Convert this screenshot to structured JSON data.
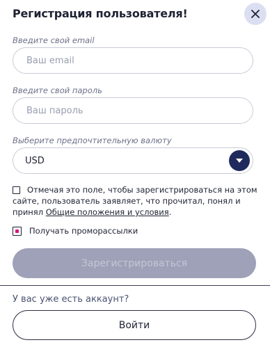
{
  "modal": {
    "title": "Регистрация пользователя!"
  },
  "form": {
    "email": {
      "label": "Введите свой email",
      "placeholder": "Ваш email",
      "value": ""
    },
    "password": {
      "label": "Введите свой пароль",
      "placeholder": "Ваш пароль",
      "value": ""
    },
    "currency": {
      "label": "Выберите предпочтительную валюту",
      "selected": "USD"
    },
    "terms": {
      "text": "Отмечая это поле, чтобы зарегистрироваться на этом сайте, пользователь заявляет, что прочитал, понял и принял",
      "link": "Общие положения и условия",
      "suffix": ".",
      "checked": false
    },
    "promo": {
      "label": "Получать проморассылки",
      "checked": true
    },
    "submit_label": "Зарегистрироваться"
  },
  "footer": {
    "question": "У вас уже есть аккаунт?",
    "login_label": "Войти"
  },
  "colors": {
    "accent": "#1f2a5c",
    "checkbox_mark": "#d8177f",
    "disabled_button": "#9ea1b8"
  },
  "icons": {
    "close": "close-icon",
    "dropdown": "chevron-down-icon"
  }
}
